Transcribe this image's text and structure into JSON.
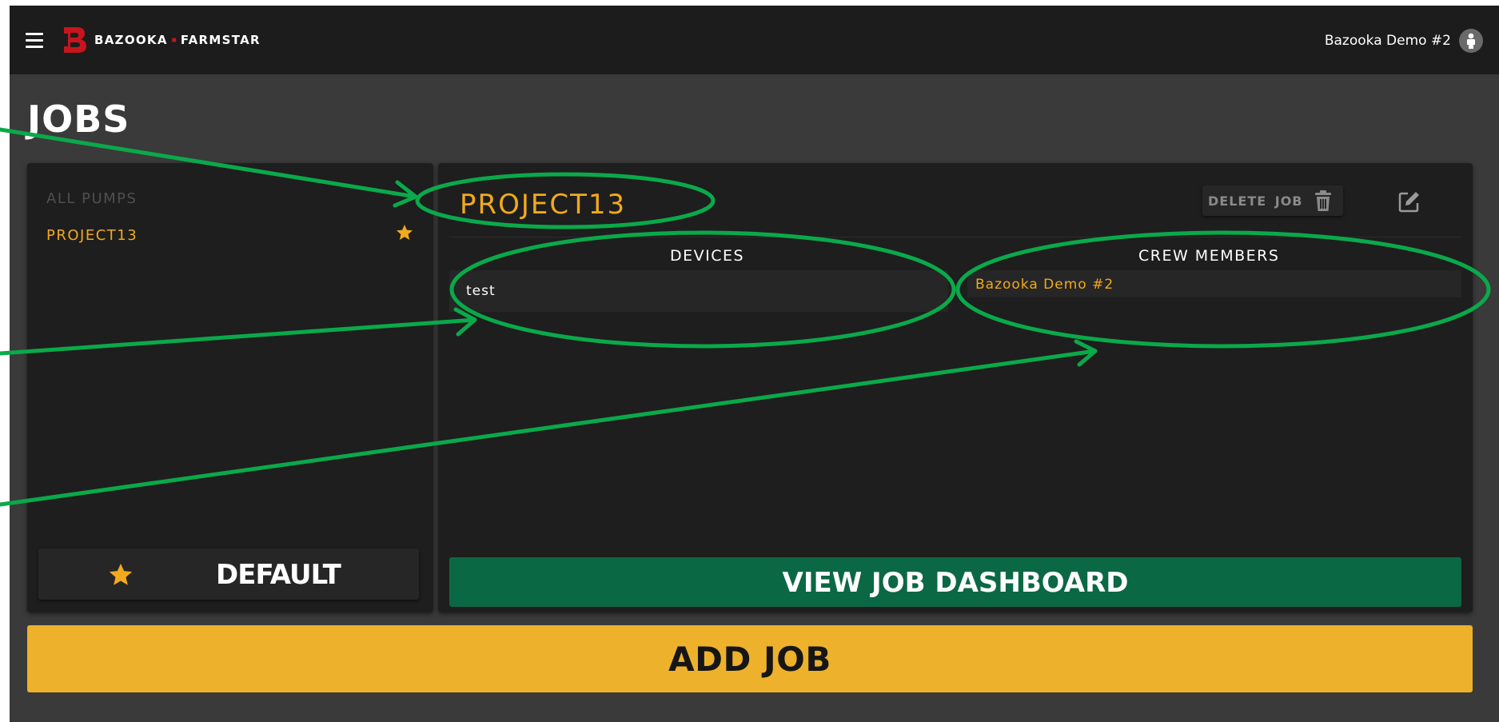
{
  "header": {
    "brand_left": "BAZOOKA",
    "brand_separator": "■",
    "brand_right": "FARMSTAR",
    "user_name": "Bazooka Demo #2",
    "menu_icon": "hamburger-menu-icon",
    "avatar_icon": "user-avatar-icon"
  },
  "page": {
    "title": "JOBS"
  },
  "job_list": {
    "all_pumps_label": "ALL PUMPS",
    "items": [
      {
        "label": "PROJECT13",
        "starred": true
      }
    ],
    "default_button_label": "DEFAULT"
  },
  "job_detail": {
    "name": "PROJECT13",
    "delete_button_label": "DELETE JOB",
    "devices_header": "DEVICES",
    "crew_header": "CREW MEMBERS",
    "devices": [
      "test"
    ],
    "crew_members": [
      "Bazooka Demo #2"
    ],
    "view_dashboard_label": "VIEW JOB DASHBOARD"
  },
  "actions": {
    "add_job_label": "ADD JOB"
  },
  "colors": {
    "accent": "#f2a91c",
    "brand_red": "#c8141d",
    "dashboard_green": "#0b6844",
    "add_job_yellow": "#edb12b",
    "annotation_green": "#0aa94a"
  }
}
